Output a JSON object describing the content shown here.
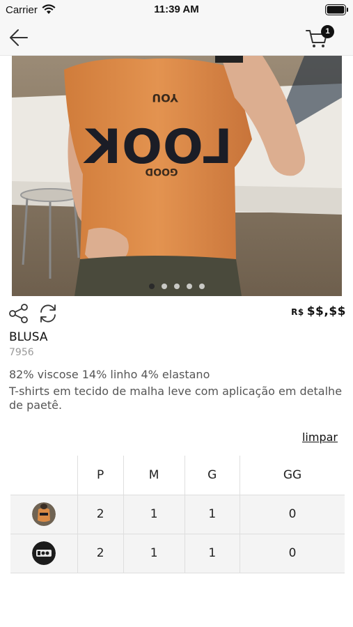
{
  "status_bar": {
    "carrier": "Carrier",
    "time": "11:39 AM"
  },
  "nav": {
    "back_icon": "arrow-left-icon",
    "cart_icon": "shopping-cart-icon",
    "cart_count": "1"
  },
  "gallery": {
    "image": "orange LOOK sequin t-shirt photo",
    "image_print_top": "YOU",
    "image_print_main": "LOOK",
    "image_print_bottom": "GOOD",
    "total_pages": 5,
    "current_page": 1
  },
  "actions": {
    "share_icon": "share-icon",
    "refresh_icon": "refresh-icon"
  },
  "product": {
    "currency": "R$",
    "price": "$$,$$",
    "title": "BLUSA",
    "code": "7956",
    "composition": "82% viscose 14% linho 4% elastano",
    "description": "T-shirts em tecido de malha leve com aplicação em detalhe de paetê."
  },
  "grid": {
    "clear_label": "limpar",
    "sizes": [
      "P",
      "M",
      "G",
      "GG"
    ],
    "rows": [
      {
        "color": "orange",
        "quantities": [
          "2",
          "1",
          "1",
          "0"
        ]
      },
      {
        "color": "black",
        "quantities": [
          "2",
          "1",
          "1",
          "0"
        ]
      }
    ]
  },
  "colors": {
    "orange": "#d98a45",
    "black": "#1c1c1c",
    "border": "#dedede"
  }
}
